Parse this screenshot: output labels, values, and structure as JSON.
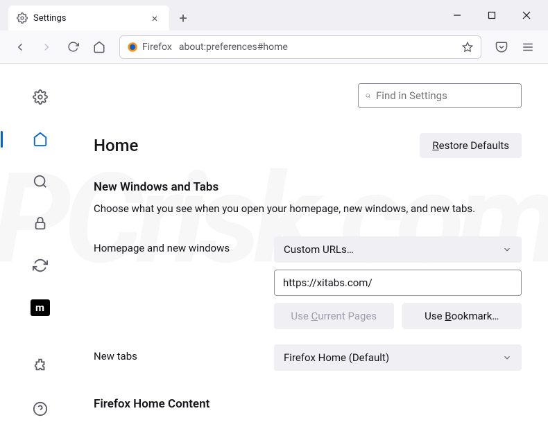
{
  "tab": {
    "title": "Settings"
  },
  "toolbar": {
    "url_prefix": "Firefox",
    "url": "about:preferences#home"
  },
  "search": {
    "placeholder": "Find in Settings"
  },
  "page": {
    "title": "Home",
    "restore_label": "Restore Defaults"
  },
  "section": {
    "heading": "New Windows and Tabs",
    "description": "Choose what you see when you open your homepage, new windows, and new tabs."
  },
  "homepage": {
    "label": "Homepage and new windows",
    "select_value": "Custom URLs…",
    "url_value": "https://xitabs.com/",
    "use_current": "Use Current Pages",
    "use_bookmark": "Use Bookmark…"
  },
  "newtabs": {
    "label": "New tabs",
    "select_value": "Firefox Home (Default)"
  },
  "content_section": {
    "heading": "Firefox Home Content"
  }
}
